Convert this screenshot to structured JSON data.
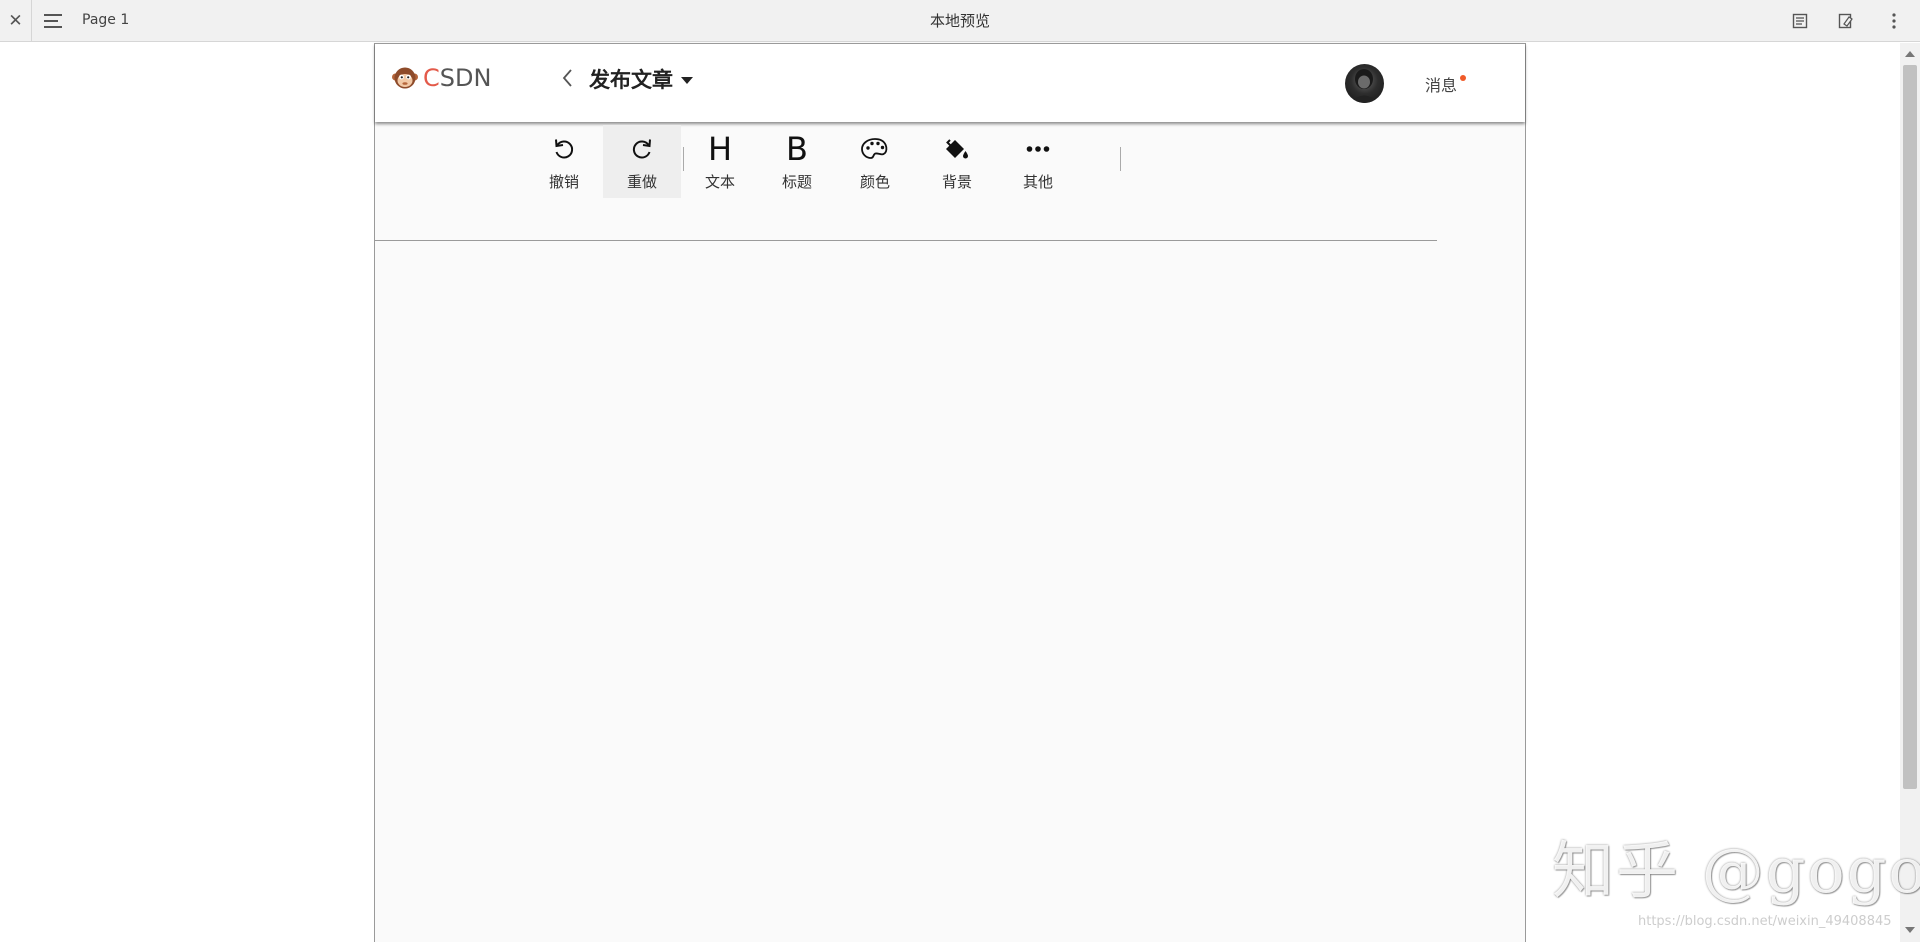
{
  "viewer": {
    "page_label": "Page 1",
    "title": "本地预览"
  },
  "header": {
    "logo_text_c": "C",
    "logo_text_rest": "SDN",
    "publish_title": "发布文章",
    "messages_label": "消息",
    "has_unread": true,
    "accent_color": "#f05a28",
    "brand_color": "#e35a4a"
  },
  "toolbar": {
    "items": [
      {
        "id": "undo",
        "label": "撤销",
        "icon": "undo-icon"
      },
      {
        "id": "redo",
        "label": "重做",
        "icon": "redo-icon",
        "active": true
      },
      {
        "id": "text",
        "label": "文本",
        "icon": "heading-h-icon",
        "glyph": "H"
      },
      {
        "id": "heading",
        "label": "标题",
        "icon": "bold-b-icon",
        "glyph": "B"
      },
      {
        "id": "color",
        "label": "颜色",
        "icon": "palette-icon"
      },
      {
        "id": "background",
        "label": "背景",
        "icon": "paint-bucket-icon"
      },
      {
        "id": "more",
        "label": "其他",
        "icon": "more-dots-icon",
        "glyph": "•••"
      }
    ]
  },
  "watermark": {
    "main": "知乎 @gogo",
    "url": "https://blog.csdn.net/weixin_49408845"
  }
}
